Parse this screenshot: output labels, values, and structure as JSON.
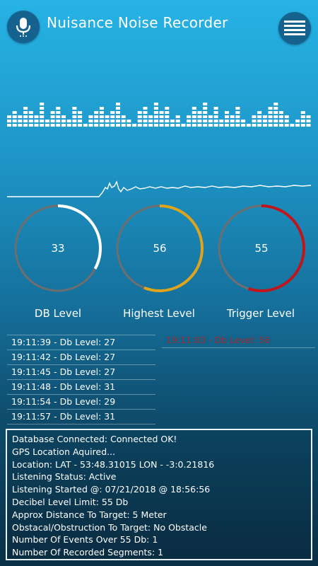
{
  "app": {
    "title": "Nuisance Noise Recorder"
  },
  "icons": {
    "record": "microphone-icon",
    "menu": "hamburger-menu-icon"
  },
  "colors": {
    "accent_white": "#ffffff",
    "highest": "#e0a41c",
    "trigger": "#c0151a",
    "track": "#6e6e6e",
    "trigger_text": "#a32a2a"
  },
  "gauges": [
    {
      "id": "db-level",
      "value": "33",
      "label": "DB Level",
      "level": 0.33,
      "color": "#ffffff"
    },
    {
      "id": "highest-level",
      "value": "56",
      "label": "Highest  Level",
      "level": 0.56,
      "color": "#e0a41c"
    },
    {
      "id": "trigger-level",
      "value": "55",
      "label": "Trigger Level",
      "level": 0.55,
      "color": "#c0151a"
    }
  ],
  "log": [
    "19:11:39 - Db Level: 27",
    "19:11:42 - Db Level: 27",
    "19:11:45 - Db Level: 27",
    "19:11:48 - Db Level: 31",
    "19:11:54 - Db Level: 29",
    "19:11:57 - Db Level: 31"
  ],
  "trigger_log": "19:11:03 - Db Level: 56",
  "status": [
    "Database Connected: Connected OK!",
    "GPS Location Aquired...",
    "Location: LAT - 53:48.31015 LON - -3:0.21816",
    "Listening Status: Active",
    "Listening Started @: 07/21/2018 @ 18:56:56",
    "Decibel Level Limit: 55 Db",
    "Approx Distance To Target: 5 Meter",
    "Obstacal/Obstruction To Target: No Obstacle",
    "Number Of Events Over 55 Db: 1",
    "Number Of Recorded Segments: 1"
  ]
}
